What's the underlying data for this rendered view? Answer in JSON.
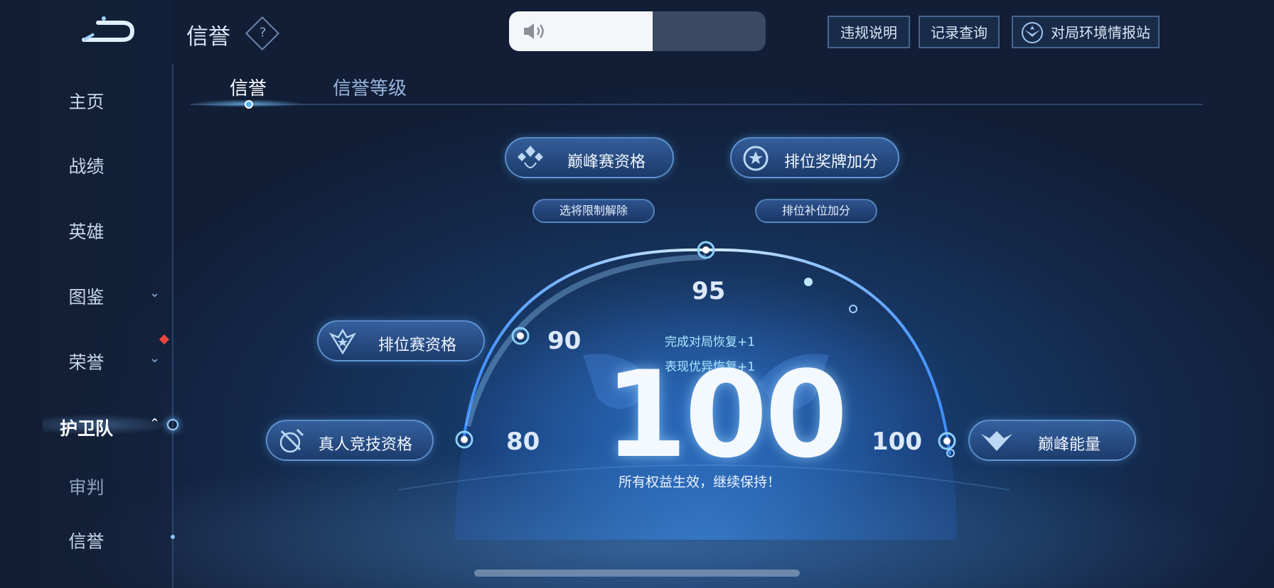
{
  "header": {
    "title": "信誉",
    "help_symbol": "?",
    "buttons": {
      "violation": "违规说明",
      "records": "记录查询",
      "env_report": "对局环境情报站"
    }
  },
  "sidebar": {
    "items": [
      {
        "label": "主页"
      },
      {
        "label": "战绩"
      },
      {
        "label": "英雄"
      },
      {
        "label": "图鉴"
      },
      {
        "label": "荣誉"
      },
      {
        "label": "护卫队"
      },
      {
        "label": "审判"
      },
      {
        "label": "信誉"
      }
    ],
    "active_index": 5
  },
  "tabs": [
    {
      "label": "信誉",
      "active": true
    },
    {
      "label": "信誉等级",
      "active": false
    }
  ],
  "credit": {
    "score": "100",
    "recover_match": "完成对局恢复+1",
    "recover_performance": "表现优异恢复+1",
    "status": "所有权益生效，继续保持！",
    "thresholds": {
      "t80": "80",
      "t90": "90",
      "t95": "95",
      "t100": "100"
    },
    "benefits": {
      "peak_qualification": "巅峰赛资格",
      "peak_sub": "选将限制解除",
      "rank_medal": "排位奖牌加分",
      "rank_sub": "排位补位加分",
      "ranked_qualification": "排位赛资格",
      "realperson_qualification": "真人竞技资格",
      "peak_energy": "巅峰能量"
    }
  },
  "audio": {
    "volume_level": 0.56
  },
  "colors": {
    "accent": "#59b3ff",
    "alert": "#e8463b"
  }
}
